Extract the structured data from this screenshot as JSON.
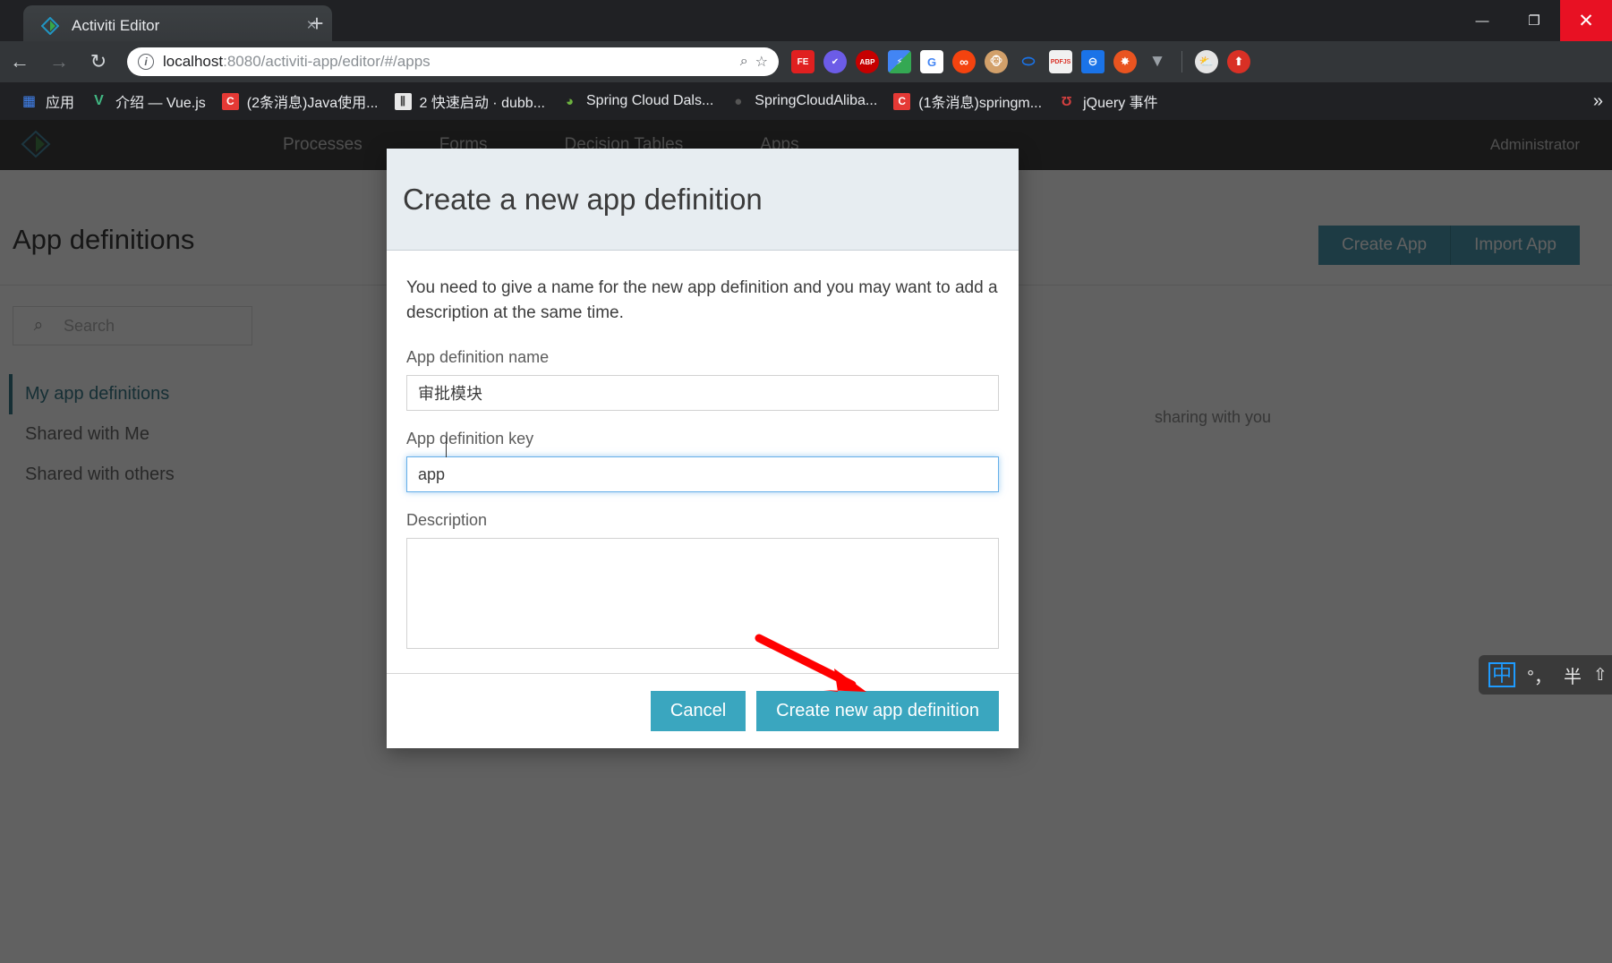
{
  "browser": {
    "tab": {
      "title": "Activiti Editor",
      "favicon": "activiti-diamond-icon",
      "close": "×"
    },
    "new_tab": "+",
    "window_controls": {
      "minimize": "—",
      "maximize": "❐",
      "close": "✕"
    },
    "nav": {
      "back": "←",
      "forward": "→",
      "reload": "↻"
    },
    "omnibox": {
      "info_icon": "i",
      "url_host": "localhost",
      "url_path": ":8080/activiti-app/editor/#/apps",
      "zoom_icon": "⌕",
      "bookmark_icon": "☆"
    },
    "extensions": [
      {
        "name": "feedly-extension",
        "glyph": "FE",
        "bg": "#e02020"
      },
      {
        "name": "checkmark-extension",
        "glyph": "✔",
        "bg": "#6c5ce7"
      },
      {
        "name": "adblock-plus-extension",
        "glyph": "ABP",
        "bg": "#c60000"
      },
      {
        "name": "lightshot-extension",
        "glyph": "⚡",
        "bg": "#4285f4"
      },
      {
        "name": "google-translate-extension",
        "glyph": "G文",
        "bg": "#4285f4"
      },
      {
        "name": "infinity-newtab-extension",
        "glyph": "∞",
        "bg": "#f4430f"
      },
      {
        "name": "monkey-extension",
        "glyph": "🐵",
        "bg": "#d2a06a"
      },
      {
        "name": "leaf-extension",
        "glyph": "○",
        "bg": "#1a73e8"
      },
      {
        "name": "pdfjs-extension",
        "glyph": "PDF",
        "bg": "#d93025"
      },
      {
        "name": "proxy-switchy-extension",
        "glyph": "⊖",
        "bg": "#1a73e8"
      },
      {
        "name": "ubuntu-extension",
        "glyph": "✺",
        "bg": "#e95420"
      },
      {
        "name": "vue-devtools-extension",
        "glyph": "V",
        "bg": "#9aa0a6"
      },
      {
        "name": "weather-extension",
        "glyph": "⛅",
        "bg": "#e0e0e0"
      },
      {
        "name": "upload-extension",
        "glyph": "⬆",
        "bg": "#d93025"
      }
    ],
    "bookmarks": [
      {
        "name": "apps-grid",
        "label": "应用",
        "glyph": "▦",
        "bg": "transparent",
        "color": "#4285f4"
      },
      {
        "name": "vuejs",
        "label": "介绍 — Vue.js",
        "glyph": "V",
        "bg": "transparent",
        "color": "#41b883"
      },
      {
        "name": "csdn-java",
        "label": "(2条消息)Java使用...",
        "glyph": "C",
        "bg": "#e53935",
        "color": "#ffffff"
      },
      {
        "name": "dubbo-quickstart",
        "label": "2 快速启动 · dubb...",
        "glyph": "‖",
        "bg": "#e8e8e8",
        "color": "#444444"
      },
      {
        "name": "spring-cloud-dalston",
        "label": "Spring Cloud Dals...",
        "glyph": "◔",
        "bg": "transparent",
        "color": "#6db33f"
      },
      {
        "name": "spring-cloud-alibaba",
        "label": "SpringCloudAliba...",
        "glyph": "●",
        "bg": "transparent",
        "color": "#555555"
      },
      {
        "name": "csdn-springmvc",
        "label": "(1条消息)springm...",
        "glyph": "C",
        "bg": "#e53935",
        "color": "#ffffff"
      },
      {
        "name": "jquery-events",
        "label": "jQuery 事件",
        "glyph": "ʘ",
        "bg": "transparent",
        "color": "#d64040"
      }
    ],
    "bookmarks_overflow": "»"
  },
  "app": {
    "nav_items": [
      "Processes",
      "Forms",
      "Decision Tables",
      "Apps"
    ],
    "user": "Administrator",
    "page_title": "App definitions",
    "actions": [
      "Create App",
      "Import App"
    ],
    "search": {
      "placeholder": "Search",
      "icon": "search-icon"
    },
    "sidebar": [
      {
        "label": "My app definitions",
        "active": true
      },
      {
        "label": "Shared with Me",
        "active": false
      },
      {
        "label": "Shared with others",
        "active": false
      }
    ],
    "empty_text": "sharing with you"
  },
  "modal": {
    "title": "Create a new app definition",
    "intro": "You need to give a name for the new app definition and you may want to add a description at the same time.",
    "fields": {
      "name_label": "App definition name",
      "name_value": "审批模块",
      "name_placeholder": "",
      "key_label": "App definition key",
      "key_value": "app",
      "key_placeholder": "",
      "description_label": "Description",
      "description_value": "",
      "description_placeholder": ""
    },
    "buttons": {
      "cancel": "Cancel",
      "create": "Create new app definition"
    },
    "colors": {
      "header_bg": "#e7edf1",
      "button": "#3aa6bf",
      "focus_border": "#66afe9",
      "annotation_arrow": "#ff0000"
    }
  },
  "ime": {
    "mode": "中",
    "punctuation": "°，",
    "width": "半",
    "shift": "⇧"
  }
}
